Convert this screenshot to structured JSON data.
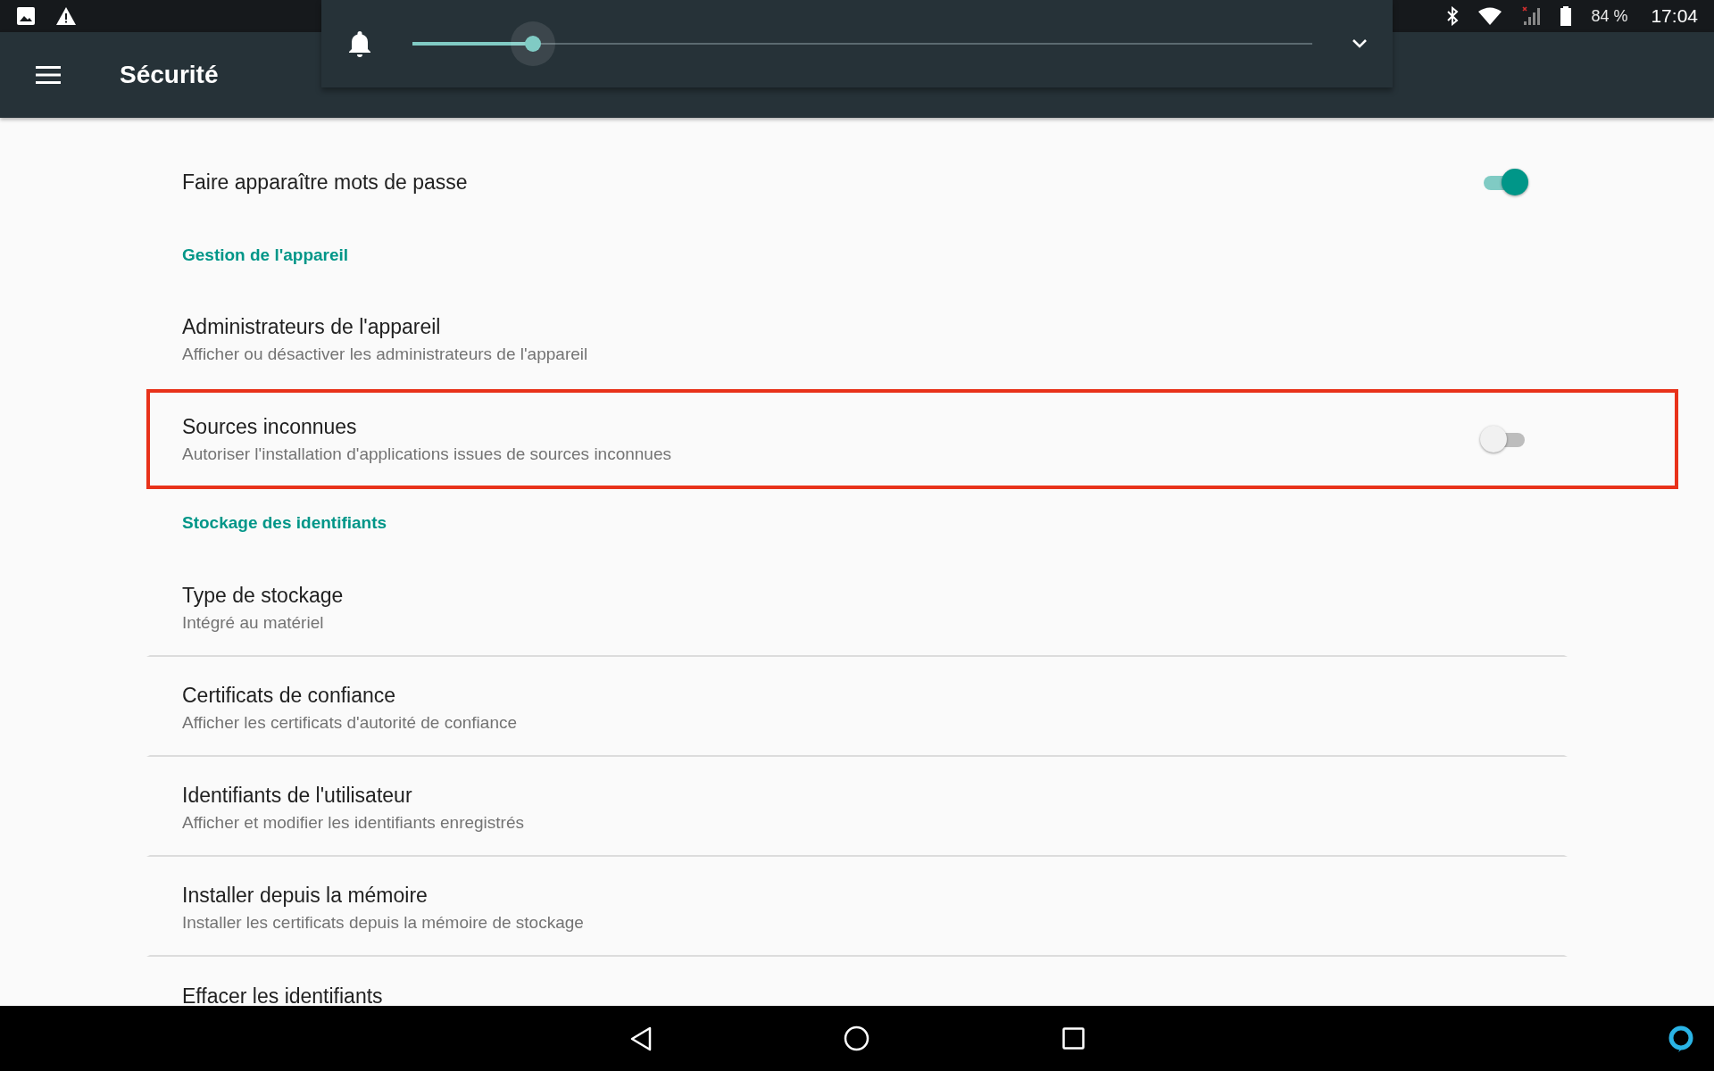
{
  "status_bar": {
    "battery": "84 %",
    "time": "17:04"
  },
  "app_bar": {
    "title": "Sécurité"
  },
  "volume_panel": {
    "level": 0.134
  },
  "items": [
    {
      "kind": "switch",
      "title": "Faire apparaître mots de passe",
      "on": true,
      "divider": false,
      "highlighted": false
    },
    {
      "kind": "header",
      "title": "Gestion de l'appareil"
    },
    {
      "kind": "text",
      "title": "Administrateurs de l'appareil",
      "subtitle": "Afficher ou désactiver les administrateurs de l'appareil",
      "divider": false,
      "highlighted": false
    },
    {
      "kind": "switch",
      "title": "Sources inconnues",
      "subtitle": "Autoriser l'installation d'applications issues de sources inconnues",
      "on": false,
      "divider": false,
      "highlighted": true
    },
    {
      "kind": "header",
      "title": "Stockage des identifiants"
    },
    {
      "kind": "text",
      "title": "Type de stockage",
      "subtitle": "Intégré au matériel",
      "divider": true,
      "highlighted": false
    },
    {
      "kind": "text",
      "title": "Certificats de confiance",
      "subtitle": "Afficher les certificats d'autorité de confiance",
      "divider": true,
      "highlighted": false
    },
    {
      "kind": "text",
      "title": "Identifiants de l'utilisateur",
      "subtitle": "Afficher et modifier les identifiants enregistrés",
      "divider": true,
      "highlighted": false
    },
    {
      "kind": "text",
      "title": "Installer depuis la mémoire",
      "subtitle": "Installer les certificats depuis la mémoire de stockage",
      "divider": true,
      "highlighted": false
    },
    {
      "kind": "text",
      "title": "Effacer les identifiants",
      "divider": false,
      "highlighted": false
    }
  ]
}
